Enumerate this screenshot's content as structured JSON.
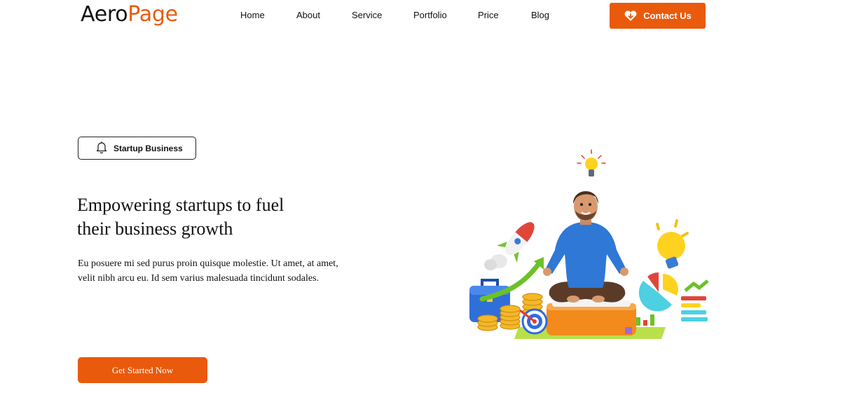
{
  "brand": {
    "part1": "Aero",
    "part2": "Page"
  },
  "nav": {
    "items": [
      "Home",
      "About",
      "Service",
      "Portfolio",
      "Price",
      "Blog"
    ]
  },
  "header": {
    "contact_label": "Contact Us",
    "contact_icon": "heart-download-icon"
  },
  "hero": {
    "badge_label": "Startup Business",
    "badge_icon": "bell-icon",
    "title_line1": "Empowering startups to fuel",
    "title_line2": "their business growth",
    "text_line1": "Eu posuere mi sed purus proin quisque molestie. Ut amet, at amet,",
    "text_line2": "velit nibh arcu eu. Id sem varius malesuada tincidunt sodales.",
    "cta_label": "Get Started Now"
  },
  "colors": {
    "accent": "#ea5a0c",
    "text": "#111111",
    "background": "#ffffff"
  }
}
